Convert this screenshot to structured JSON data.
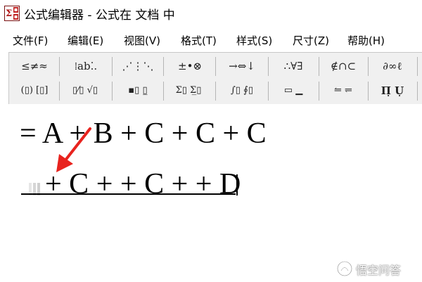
{
  "window": {
    "title": "公式编辑器 - 公式在 文档 中",
    "app_icon": "equation-editor-icon"
  },
  "menu": {
    "items": [
      {
        "label": "文件(F)"
      },
      {
        "label": "编辑(E)"
      },
      {
        "label": "视图(V)"
      },
      {
        "label": "格式(T)"
      },
      {
        "label": "样式(S)"
      },
      {
        "label": "尺寸(Z)"
      },
      {
        "label": "帮助(H)"
      }
    ]
  },
  "toolbar": {
    "row1": [
      {
        "label": "≤≠≈",
        "icon": "relational-symbols"
      },
      {
        "label": "⁞ab⁚.",
        "icon": "spaces-ellipses"
      },
      {
        "label": "⋰⋮⋱",
        "icon": "embellishments"
      },
      {
        "label": "±•⊗",
        "icon": "operator-symbols"
      },
      {
        "label": "→⇔↓",
        "icon": "arrow-symbols"
      },
      {
        "label": "∴∀∃",
        "icon": "logical-symbols"
      },
      {
        "label": "∉∩⊂",
        "icon": "set-theory-symbols"
      },
      {
        "label": "∂∞ℓ",
        "icon": "misc-symbols"
      }
    ],
    "row2": [
      {
        "label": "(▯) [▯]",
        "icon": "fence-templates"
      },
      {
        "label": "▯⁄▯ √▯",
        "icon": "fraction-radical-templates"
      },
      {
        "label": "▪▯ ▯̲",
        "icon": "subscript-superscript-templates"
      },
      {
        "label": "Σ▯ Σ̲▯",
        "icon": "summation-templates"
      },
      {
        "label": "∫▯ ∮▯",
        "icon": "integral-templates"
      },
      {
        "label": "▭ ▁",
        "icon": "underbar-overbar-templates"
      },
      {
        "label": "⥪ ⥫",
        "icon": "labeled-arrow-templates"
      },
      {
        "label": "Π̣ Ụ",
        "icon": "product-templates"
      }
    ]
  },
  "editor": {
    "line1": "= A + B + C + C + C",
    "line2": "+ C + + C + + D"
  },
  "annotation": {
    "arrow_color": "#e8231e"
  },
  "watermark": {
    "text": "悟空问答",
    "icon": "wukong-logo-icon"
  },
  "colors": {
    "toolbar_bg": "#f0f0f0",
    "arrow": "#e8231e"
  }
}
